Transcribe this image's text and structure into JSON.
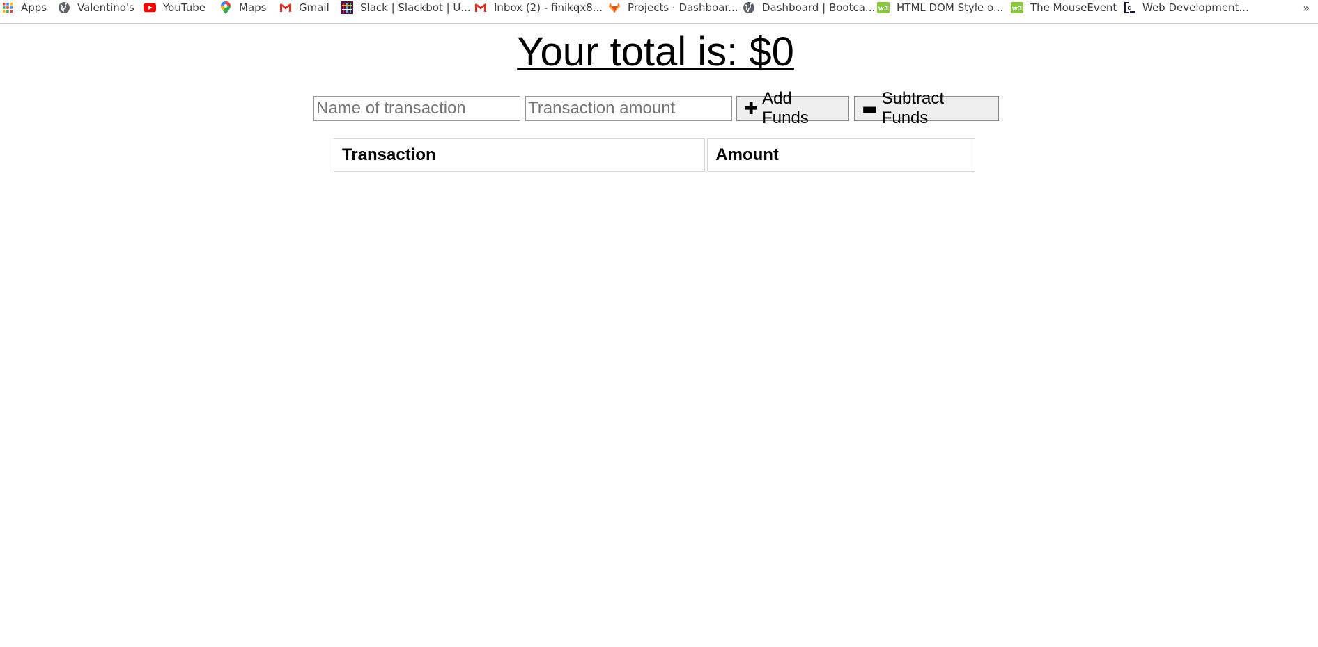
{
  "bookmarks": {
    "items": [
      {
        "label": "Apps",
        "icon": "apps-grid-icon"
      },
      {
        "label": "Valentino's",
        "icon": "globe-icon"
      },
      {
        "label": "YouTube",
        "icon": "youtube-icon"
      },
      {
        "label": "Maps",
        "icon": "maps-pin-icon"
      },
      {
        "label": "Gmail",
        "icon": "gmail-icon"
      },
      {
        "label": "Slack | Slackbot | U...",
        "icon": "slack-icon"
      },
      {
        "label": "Inbox (2) - finikqx8...",
        "icon": "gmail-icon"
      },
      {
        "label": "Projects · Dashboar...",
        "icon": "gitlab-icon"
      },
      {
        "label": "Dashboard | Bootca...",
        "icon": "globe-icon"
      },
      {
        "label": "HTML DOM Style o...",
        "icon": "w3schools-icon"
      },
      {
        "label": "The MouseEvent",
        "icon": "w3schools-icon"
      },
      {
        "label": "Web Development...",
        "icon": "codepen-icon"
      }
    ],
    "overflow": "»"
  },
  "total": {
    "text": "Your total is: $0"
  },
  "form": {
    "name_placeholder": "Name of transaction",
    "amount_placeholder": "Transaction amount",
    "add_glyph": "✚",
    "add_label": "Add Funds",
    "subtract_glyph": "▬",
    "subtract_label": "Subtract Funds"
  },
  "table": {
    "headers": [
      "Transaction",
      "Amount"
    ]
  },
  "colors": {
    "youtube_red": "#ff0000",
    "gmail_red": "#d93025",
    "gitlab_orange": "#e24329",
    "w3schools_green": "#8ac640",
    "slack_purple": "#4a154b"
  }
}
